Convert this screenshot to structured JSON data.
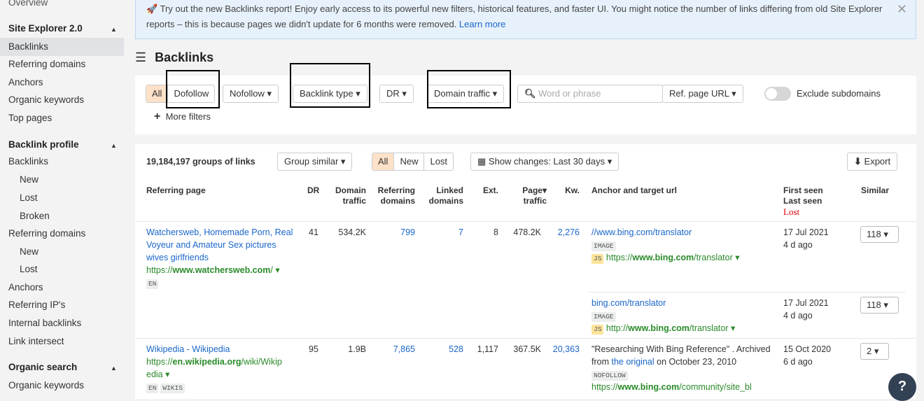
{
  "sidebar": {
    "overview": "Overview",
    "site_explorer": "Site Explorer 2.0",
    "backlinks": "Backlinks",
    "referring_domains": "Referring domains",
    "anchors": "Anchors",
    "organic_keywords": "Organic keywords",
    "top_pages": "Top pages",
    "backlink_profile": "Backlink profile",
    "bp_backlinks": "Backlinks",
    "bp_new": "New",
    "bp_lost": "Lost",
    "bp_broken": "Broken",
    "bp_referring_domains": "Referring domains",
    "rd_new": "New",
    "rd_lost": "Lost",
    "bp_anchors": "Anchors",
    "referring_ips": "Referring IP's",
    "internal_backlinks": "Internal backlinks",
    "link_intersect": "Link intersect",
    "organic_search": "Organic search",
    "os_organic_keywords": "Organic keywords"
  },
  "banner": {
    "text": "Try out the new Backlinks report! Enjoy early access to its powerful new filters, historical features, and faster UI. You might notice the number of links differing from old Site Explorer reports – this is because pages we didn't update for 6 months were removed.",
    "link": "Learn more"
  },
  "page_title": "Backlinks",
  "filters": {
    "all": "All",
    "dofollow": "Dofollow",
    "nofollow": "Nofollow",
    "backlink_type": "Backlink type",
    "dr": "DR",
    "domain_traffic": "Domain traffic",
    "search_placeholder": "Word or phrase",
    "ref_page_url": "Ref. page URL",
    "exclude_subdomains": "Exclude subdomains",
    "more_filters": "More filters"
  },
  "toolbar": {
    "count": "19,184,197 groups of links",
    "group_similar": "Group similar",
    "all": "All",
    "new": "New",
    "lost": "Lost",
    "show_changes": "Show changes: Last 30 days",
    "export": "Export"
  },
  "columns": {
    "referring_page": "Referring page",
    "dr": "DR",
    "domain": "Domain",
    "traffic": "traffic",
    "referring": "Referring",
    "domains": "domains",
    "linked": "Linked",
    "linked_domains": "domains",
    "ext": "Ext.",
    "page": "Page",
    "page_traffic": "traffic",
    "kw": "Kw.",
    "anchor": "Anchor and target url",
    "first_seen": "First seen",
    "last_seen": "Last seen",
    "lost": "Lost",
    "similar": "Similar"
  },
  "rows": [
    {
      "title": "Watchersweb, Homemade Porn, Real Voyeur and Amateur Sex pictures wives girlfriends",
      "url_pre": "https://",
      "url_bold": "www.watchersweb.com",
      "url_post": "/ ▾",
      "lang": "EN",
      "dr": "41",
      "domain_traffic": "534.2K",
      "ref_domains": "799",
      "linked_domains": "7",
      "ext": "8",
      "page_traffic": "478.2K",
      "kw": "2,276",
      "anchors": [
        {
          "anchor": "//www.bing.com/translator",
          "tag": "IMAGE",
          "target_pre": "https://",
          "target_bold": "www.bing.com",
          "target_post": "/translator ▾",
          "first": "17 Jul 2021",
          "last": "4 d ago",
          "similar": "118 ▾"
        },
        {
          "anchor": "bing.com/translator",
          "tag": "IMAGE",
          "target_pre": "http://",
          "target_bold": "www.bing.com",
          "target_post": "/translator ▾",
          "first": "17 Jul 2021",
          "last": "4 d ago",
          "similar": "118 ▾"
        }
      ]
    },
    {
      "title": "Wikipedia - Wikipedia",
      "url_pre": "https://",
      "url_bold": "en.wikipedia.org",
      "url_post": "/wiki/Wikip",
      "url_post2": "edia ▾",
      "lang": "EN",
      "lang2": "WIKIS",
      "dr": "95",
      "domain_traffic": "1.9B",
      "ref_domains": "7,865",
      "linked_domains": "528",
      "ext": "1,117",
      "page_traffic": "367.5K",
      "kw": "20,363",
      "anchor_text": "\"Researching With Bing Reference\" . Archived from",
      "anchor_link": "the original",
      "anchor_text2": "on October 23, 2010",
      "tag": "NOFOLLOW",
      "target_pre": "https://",
      "target_bold": "www.bing.com",
      "target_post": "/community/site_bl",
      "first": "15 Oct 2020",
      "last": "6 d ago",
      "similar": "2 ▾"
    }
  ],
  "help": "?"
}
